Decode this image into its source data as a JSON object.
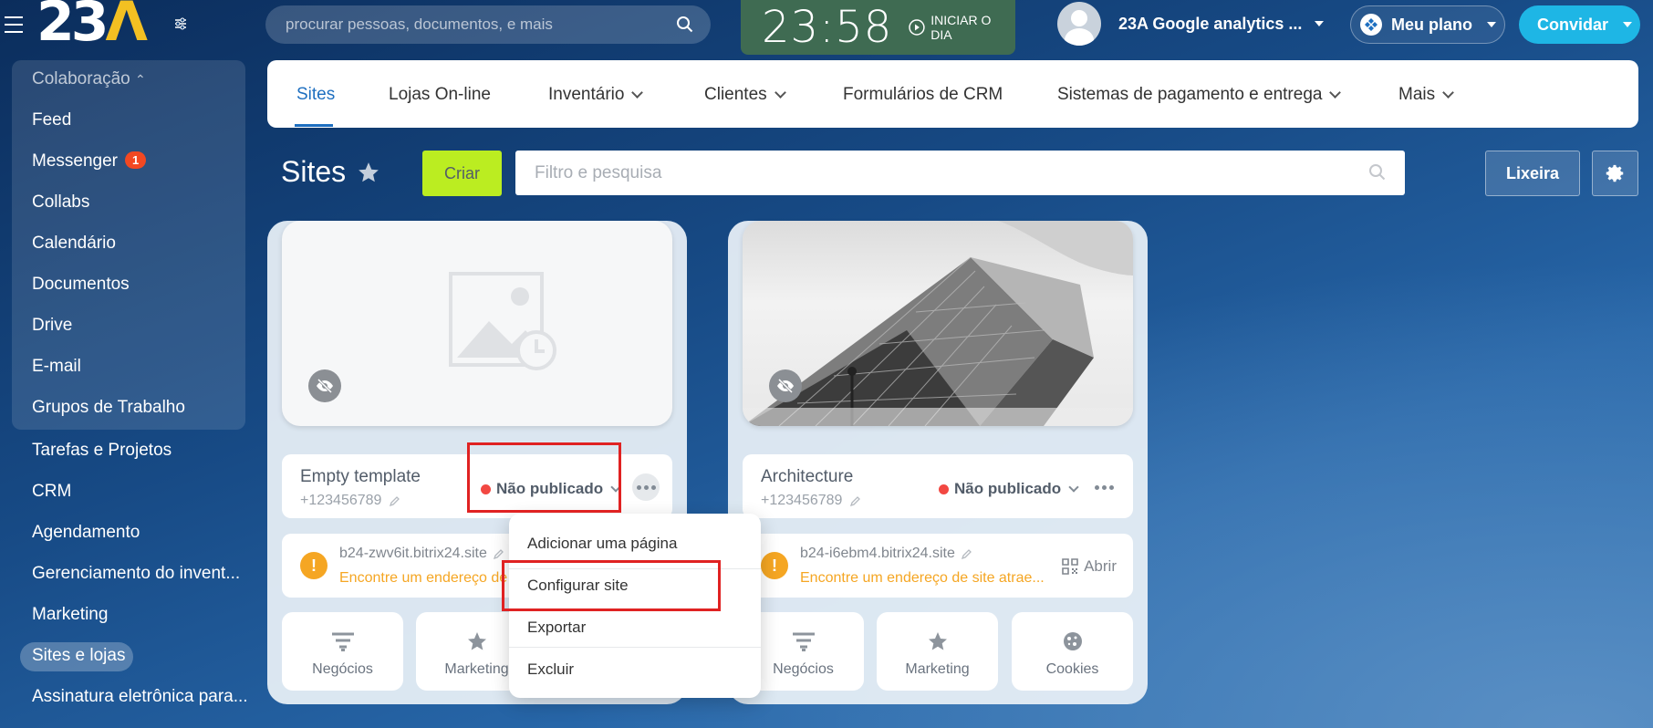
{
  "header": {
    "logo_text": "23",
    "logo_accent": "Λ",
    "search_placeholder": "procurar pessoas, documentos, e mais",
    "time": "23:58",
    "start_day": "INICIAR O DIA",
    "user_name": "23A Google analytics ...",
    "plan": "Meu plano",
    "invite": "Convidar"
  },
  "sidebar": {
    "group_title": "Colaboração",
    "items": [
      {
        "label": "Feed"
      },
      {
        "label": "Messenger",
        "badge": "1"
      },
      {
        "label": "Collabs"
      },
      {
        "label": "Calendário"
      },
      {
        "label": "Documentos"
      },
      {
        "label": "Drive"
      },
      {
        "label": "E-mail"
      },
      {
        "label": "Grupos de Trabalho"
      },
      {
        "label": "Tarefas e Projetos"
      },
      {
        "label": "CRM"
      },
      {
        "label": "Agendamento"
      },
      {
        "label": "Gerenciamento do invent..."
      },
      {
        "label": "Marketing"
      },
      {
        "label": "Sites e lojas"
      },
      {
        "label": "Assinatura eletrônica para..."
      }
    ],
    "active": "Sites e lojas"
  },
  "tabs": [
    {
      "label": "Sites",
      "active": true
    },
    {
      "label": "Lojas On-line"
    },
    {
      "label": "Inventário",
      "dropdown": true
    },
    {
      "label": "Clientes",
      "dropdown": true
    },
    {
      "label": "Formulários de CRM"
    },
    {
      "label": "Sistemas de pagamento e entrega",
      "dropdown": true
    },
    {
      "label": "Mais",
      "dropdown": true
    }
  ],
  "page": {
    "title": "Sites",
    "create": "Criar",
    "filter_placeholder": "Filtro e pesquisa",
    "trash": "Lixeira"
  },
  "sites": [
    {
      "name": "Empty template",
      "phone": "+123456789",
      "status": "Não publicado",
      "domain": "b24-zwv6it.bitrix24.site",
      "domain_hint": "Encontre um endereço de",
      "tiles": [
        "Negócios",
        "Marketing"
      ]
    },
    {
      "name": "Architecture",
      "phone": "+123456789",
      "status": "Não publicado",
      "domain": "b24-i6ebm4.bitrix24.site",
      "domain_hint": "Encontre um endereço de site atrae...",
      "open": "Abrir",
      "tiles": [
        "Negócios",
        "Marketing",
        "Cookies"
      ]
    }
  ],
  "menu": {
    "items": [
      "Adicionar uma página",
      "Configurar site",
      "Exportar",
      "Excluir"
    ]
  },
  "colors": {
    "accent": "#1e6fc0",
    "create": "#bbed21",
    "invite": "#1eb6e5",
    "status_dot": "#f24842",
    "warning": "#f5a623",
    "highlight": "#e02222"
  }
}
